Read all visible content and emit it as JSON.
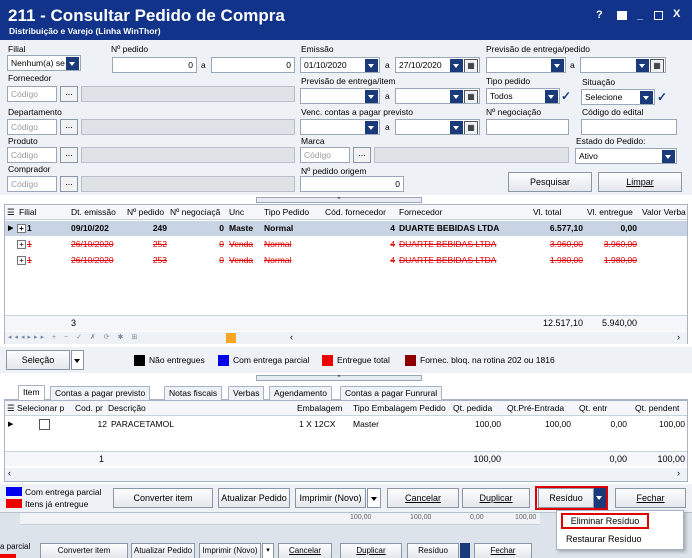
{
  "window": {
    "title": "211 - Consultar Pedido de Compra",
    "subtitle": "Distribuição e Varejo (Linha WinThor)",
    "controls": [
      "?",
      "◪",
      "_",
      "□",
      "X"
    ]
  },
  "filters": {
    "filial_label": "Filial",
    "filial_value": "Nenhum(a) se",
    "n_pedido_label": "Nº pedido",
    "n_pedido_from": "0",
    "n_pedido_to": "0",
    "a": "a",
    "emissao_label": "Emissão",
    "emissao_from": "01/10/2020",
    "emissao_to": "27/10/2020",
    "prev_entrega_pedido_label": "Previsão de entrega/pedido",
    "fornecedor_label": "Fornecedor",
    "codigo_placeholder": "Código",
    "dots": "...",
    "prev_entrega_item_label": "Previsão de entrega/item",
    "tipo_pedido_label": "Tipo pedido",
    "tipo_pedido_value": "Todos",
    "situacao_label": "Situação",
    "situacao_value": "Selecione",
    "departamento_label": "Departamento",
    "venc_contas_label": "Venc. contas a  pagar previsto",
    "n_negociacao_label": "Nº negociação",
    "codigo_edital_label": "Código do edital",
    "produto_label": "Produto",
    "marca_label": "Marca",
    "estado_pedido_label": "Estado do Pedido:",
    "estado_pedido_value": "Ativo",
    "comprador_label": "Comprador",
    "n_pedido_origem_label": "Nº pedido origem",
    "n_pedido_origem_value": "0",
    "pesquisar_label": "Pesquisar",
    "limpar_label": "Limpar"
  },
  "orders_grid": {
    "headers": [
      "Filial",
      "Dt. emissão",
      "Nº pedido",
      "Nº negociaçã",
      "Unc",
      "Tipo Pedido",
      "Cód. fornecedor",
      "Fornecedor",
      "Vl. total",
      "Vl. entregue",
      "Valor Verba"
    ],
    "rows": [
      {
        "filial": "1",
        "dt": "09/10/202",
        "pedido": "249",
        "negoc": "0",
        "unc": "Maste",
        "tipo": "Normal",
        "cod_forn": "4",
        "fornecedor": "DUARTE BEBIDAS LTDA",
        "vl_total": "6.577,10",
        "vl_entregue": "0,00",
        "style": "selected"
      },
      {
        "filial": "1",
        "dt": "26/10/2020",
        "pedido": "252",
        "negoc": "0",
        "unc": "Venda",
        "tipo": "Normal",
        "cod_forn": "4",
        "fornecedor": "DUARTE BEBIDAS LTDA",
        "vl_total": "3.960,00",
        "vl_entregue": "3.960,00",
        "style": "cancelled"
      },
      {
        "filial": "1",
        "dt": "26/10/2020",
        "pedido": "253",
        "negoc": "0",
        "unc": "Venda",
        "tipo": "Normal",
        "cod_forn": "4",
        "fornecedor": "DUARTE BEBIDAS LTDA",
        "vl_total": "1.980,00",
        "vl_entregue": "1.980,00",
        "style": "cancelled"
      }
    ],
    "footer_count": "3",
    "footer_total": "12.517,10",
    "footer_entregue": "5.940,00"
  },
  "legend": {
    "selecao_label": "Seleção",
    "items": [
      {
        "label": "Não entregues",
        "color": "#000000"
      },
      {
        "label": "Com entrega parcial",
        "color": "#0000ee"
      },
      {
        "label": "Entregue total",
        "color": "#ee0000"
      },
      {
        "label": "Fornec. bloq. na rotina 202 ou 1816",
        "color": "#8b0000"
      }
    ]
  },
  "tabs": [
    "Item",
    "Contas a pagar previsto",
    "Notas fiscais",
    "Verbas",
    "Agendamento",
    "Contas a pagar Funrural"
  ],
  "items_grid": {
    "headers": [
      "Selecionar p",
      "Cod. pr",
      "Descrição",
      "Embalagem",
      "Tipo Embalagem Pedido",
      "Qt. pedida",
      "Qt.Pré-Entrada",
      "Qt. entr",
      "Qt. pendent"
    ],
    "rows": [
      {
        "cod": "12",
        "descricao": "PARACETAMOL",
        "embalagem": "1 X 12CX",
        "tipo_emb": "Master",
        "qt_pedida": "100,00",
        "qt_pre": "100,00",
        "qt_entr": "0,00",
        "qt_pend": "100,00"
      }
    ],
    "footer_count": "1",
    "footer_pedida": "100,00",
    "footer_entr": "0,00",
    "footer_pend": "100,00"
  },
  "bottom": {
    "legend_parcial": "Com entrega parcial",
    "legend_entregue": "Itens já entregue",
    "converter_item": "Converter item",
    "atualizar_pedido": "Atualizar Pedido",
    "imprimir_novo": "Imprimir (Novo)",
    "cancelar": "Cancelar",
    "duplicar": "Duplicar",
    "residuo": "Resíduo",
    "fechar": "Fechar"
  },
  "residuo_menu": {
    "items": [
      "Eliminar Resíduo",
      "Restaurar Resíduo"
    ]
  },
  "ghost_bar": {
    "parcial": "a parcial",
    "converter_item": "Converter item",
    "atualizar_pedido": "Atualizar Pedido",
    "imprimir_novo": "Imprimir (Novo)",
    "cancelar": "Cancelar",
    "duplicar": "Duplicar",
    "residuo": "Resíduo",
    "fechar": "Fechar",
    "faded_values": [
      "100,00",
      "100,00",
      "0,00",
      "100,00"
    ]
  }
}
